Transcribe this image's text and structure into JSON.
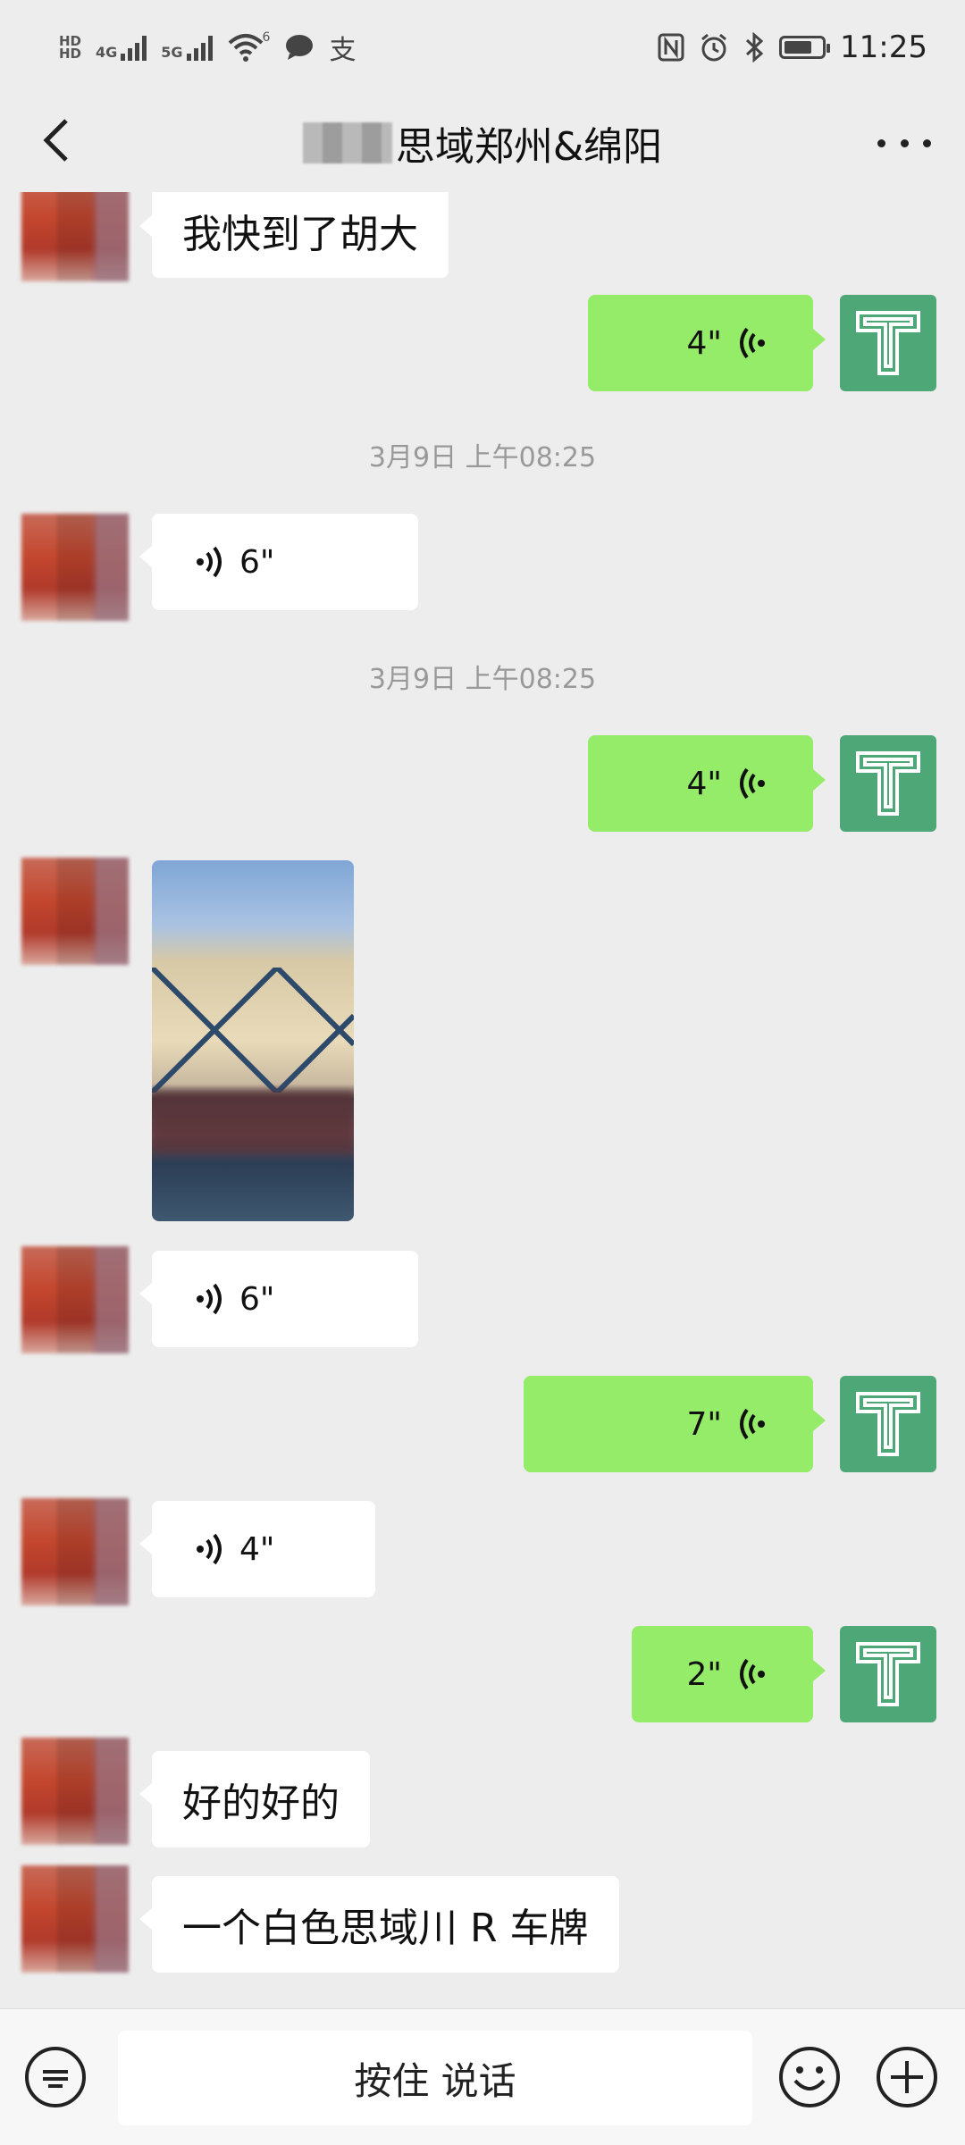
{
  "status_bar": {
    "left_mini_1": "HD",
    "left_mini_2": "HD",
    "net_1": "4G",
    "net_2": "5G",
    "wifi_badge": "6",
    "alipay_icon": "支",
    "time": "11:25",
    "icons": [
      "nfc-icon",
      "alarm-icon",
      "bluetooth-icon",
      "battery-icon"
    ]
  },
  "header": {
    "title": "思域郑州&绵阳",
    "back_icon": "chevron-left-icon",
    "more_icon": "more-icon"
  },
  "messages": [
    {
      "side": "left",
      "type": "text",
      "text": "我快到了胡大"
    },
    {
      "side": "right",
      "type": "voice",
      "duration": "4\""
    },
    {
      "type": "time",
      "text": "3月9日 上午08:25"
    },
    {
      "side": "left",
      "type": "voice",
      "duration": "6\""
    },
    {
      "type": "time",
      "text": "3月9日 上午08:25"
    },
    {
      "side": "right",
      "type": "voice",
      "duration": "4\""
    },
    {
      "side": "left",
      "type": "image"
    },
    {
      "side": "left",
      "type": "voice",
      "duration": "6\""
    },
    {
      "side": "right",
      "type": "voice",
      "duration": "7\""
    },
    {
      "side": "left",
      "type": "voice",
      "duration": "4\""
    },
    {
      "side": "right",
      "type": "voice",
      "duration": "2\""
    },
    {
      "side": "left",
      "type": "text",
      "text": "好的好的"
    },
    {
      "side": "left",
      "type": "text",
      "text": "一个白色思域川 R 车牌"
    }
  ],
  "bottom_bar": {
    "hold_to_talk": "按住 说话",
    "icons": [
      "keyboard-icon",
      "emoji-icon",
      "plus-icon"
    ]
  },
  "colors": {
    "background": "#ededed",
    "bubble_self": "#95ec69",
    "bubble_other": "#ffffff",
    "avatar_self": "#4ea776"
  }
}
